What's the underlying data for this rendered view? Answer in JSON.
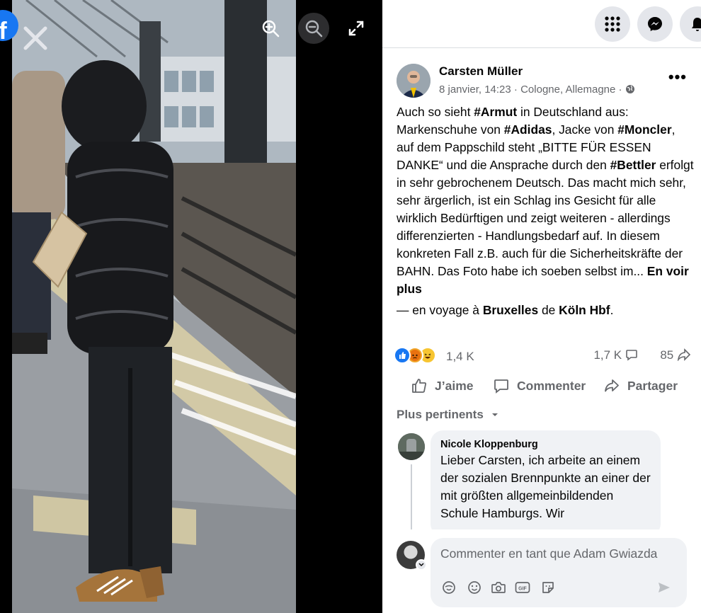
{
  "viewer": {
    "photo_alt": "",
    "logo_glyph": "f"
  },
  "topbar": {
    "menu_icon": "grid-icon",
    "messenger_icon": "messenger-icon",
    "notifications_icon": "bell-icon"
  },
  "post": {
    "author": "Carsten Müller",
    "date": "8 janvier, 14:23",
    "location": "Cologne, Allemagne",
    "separator": " · ",
    "more_label": "•••",
    "text_segments": [
      {
        "t": "Auch so sieht ",
        "b": false
      },
      {
        "t": "#Armut",
        "b": true
      },
      {
        "t": " in Deutschland aus: Markenschuhe von ",
        "b": false
      },
      {
        "t": "#Adidas",
        "b": true
      },
      {
        "t": ", Jacke von ",
        "b": false
      },
      {
        "t": "#Moncler",
        "b": true
      },
      {
        "t": ", auf dem Pappschild steht „BITTE FÜR ESSEN DANKE“ und die Ansprache durch den ",
        "b": false
      },
      {
        "t": "#Bettler",
        "b": true
      },
      {
        "t": " erfolgt in sehr gebrochenem Deutsch. Das macht mich sehr, sehr ärgerlich, ist ein Schlag ins Gesicht für alle wirklich Bedürftigen und zeigt weiteren - allerdings differenzierten - Handlungsbedarf auf. In diesem konkreten Fall z.B. auch für die Sicherheitskräfte der BAHN. Das Foto habe ich soeben selbst im... ",
        "b": false
      }
    ],
    "see_more": "En voir plus",
    "travel_prefix": "— en voyage à ",
    "travel_to": "Bruxelles",
    "travel_mid": " de ",
    "travel_from": "Köln Hbf",
    "travel_suffix": "."
  },
  "stats": {
    "reactions_count": "1,4 K",
    "comments_count": "1,7 K",
    "shares_count": "85"
  },
  "actions": {
    "like": "J’aime",
    "comment": "Commenter",
    "share": "Partager"
  },
  "comments": {
    "sort_label": "Plus pertinents",
    "items": [
      {
        "name": "Nicole Kloppenburg",
        "text": "Lieber Carsten, ich arbeite an einem der sozialen Brennpunkte an einer der mit größten allgemeinbildenden Schule Hamburgs. Wir"
      }
    ]
  },
  "composer": {
    "placeholder": "Commenter en tant que Adam Gwiazda"
  }
}
